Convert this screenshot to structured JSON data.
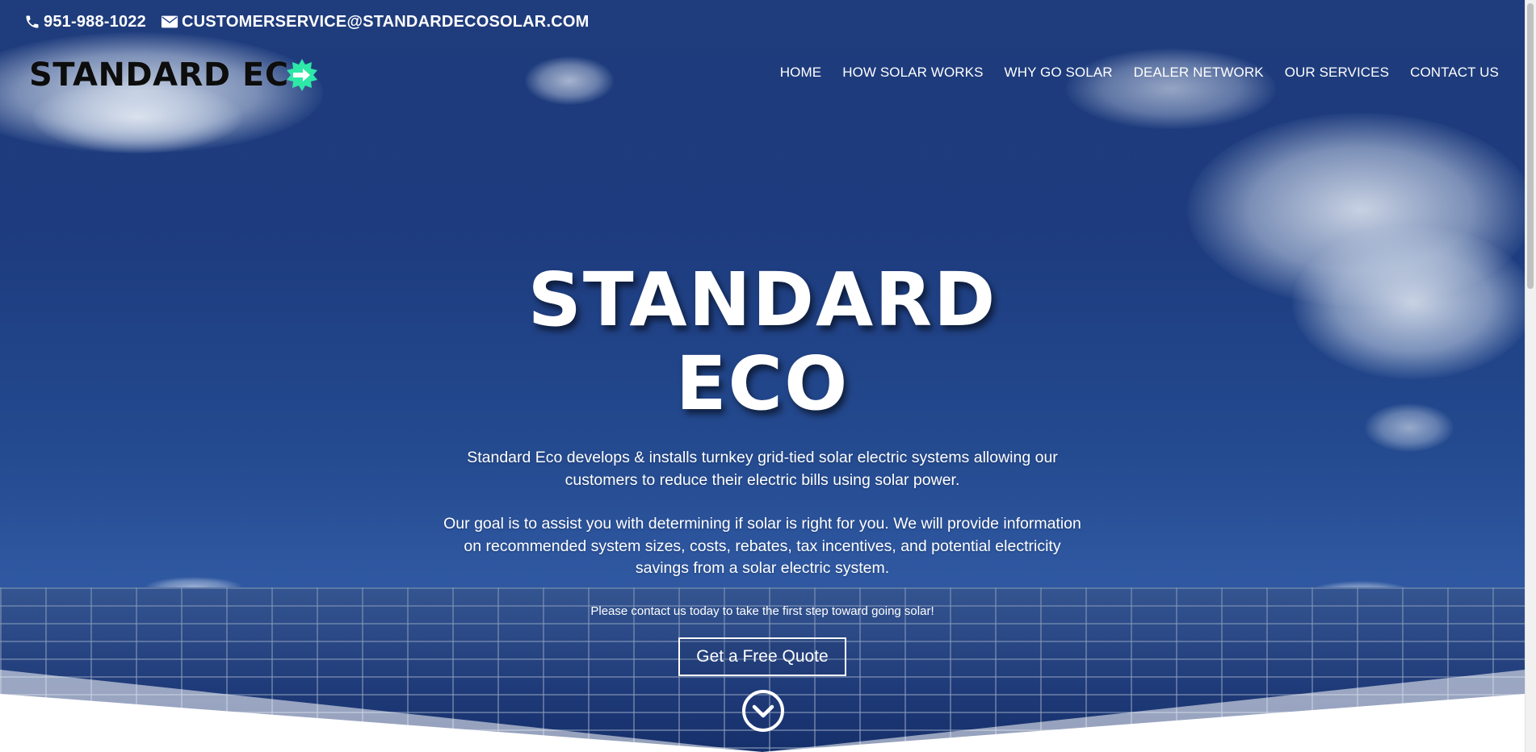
{
  "topbar": {
    "phone": "951-988-1022",
    "email": "CUSTOMERSERVICE@STANDARDECOSOLAR.COM"
  },
  "logo": {
    "text": "STANDARD EC"
  },
  "nav": {
    "items": [
      {
        "label": "HOME"
      },
      {
        "label": "HOW SOLAR WORKS"
      },
      {
        "label": "WHY GO SOLAR"
      },
      {
        "label": "DEALER NETWORK"
      },
      {
        "label": "OUR SERVICES"
      },
      {
        "label": "CONTACT US"
      }
    ]
  },
  "hero": {
    "title": "STANDARD ECO",
    "paragraph1": "Standard Eco develops & installs turnkey grid-tied solar electric systems allowing our customers to reduce their electric bills using solar power.",
    "paragraph2": "Our goal is to assist you with determining if solar is right for you. We will provide information on recommended system sizes, costs, rebates, tax incentives, and potential electricity savings from a solar electric system.",
    "cta_text": "Please contact us today to take the first step toward going solar!",
    "cta_button": "Get a Free Quote"
  },
  "colors": {
    "sky": "#1f3c7c",
    "logo_accent": "#2ee8a8",
    "white": "#ffffff"
  },
  "icons": [
    "phone-icon",
    "envelope-icon",
    "logo-arrow-icon",
    "chevron-down-circle-icon"
  ]
}
